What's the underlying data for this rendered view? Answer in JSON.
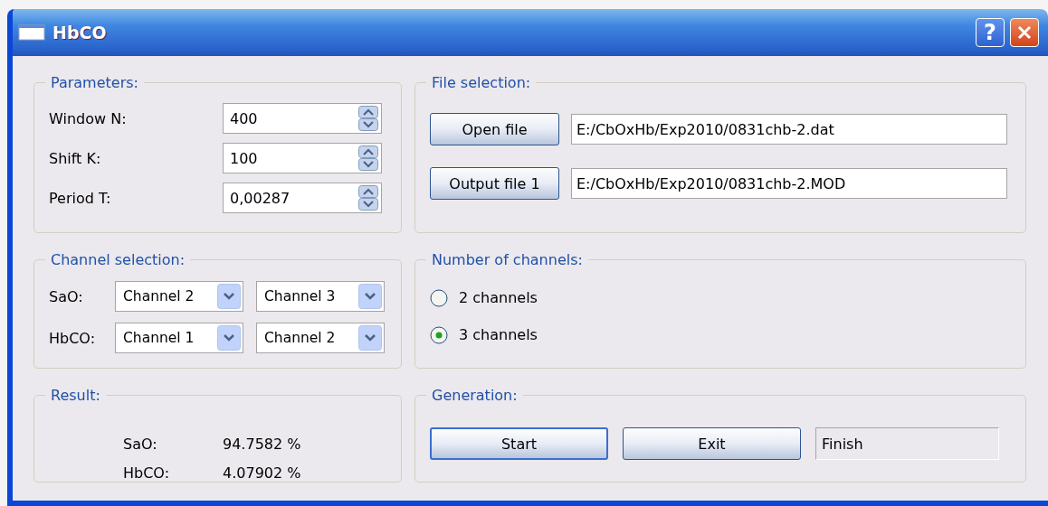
{
  "window": {
    "title": "HbCO",
    "help_button": "?"
  },
  "parameters": {
    "title": "Parameters:",
    "fields": [
      {
        "label": "Window N:",
        "value": "400"
      },
      {
        "label": "Shift K:",
        "value": "100"
      },
      {
        "label": "Period T:",
        "value": "0,00287"
      }
    ]
  },
  "file_selection": {
    "title": "File selection:",
    "rows": [
      {
        "button": "Open file",
        "path": "E:/CbOxHb/Exp2010/0831chb-2.dat"
      },
      {
        "button": "Output file 1",
        "path": "E:/CbOxHb/Exp2010/0831chb-2.MOD"
      }
    ]
  },
  "channel_selection": {
    "title": "Channel selection:",
    "rows": [
      {
        "label": "SaO:",
        "selects": [
          "Channel 2",
          "Channel 3"
        ]
      },
      {
        "label": "HbCO:",
        "selects": [
          "Channel 1",
          "Channel 2"
        ]
      }
    ]
  },
  "number_of_channels": {
    "title": "Number of channels:",
    "options": [
      {
        "label": "2 channels",
        "selected": false
      },
      {
        "label": "3 channels",
        "selected": true
      }
    ]
  },
  "result": {
    "title": "Result:",
    "rows": [
      {
        "label": "SaO:",
        "value": "94.7582 %"
      },
      {
        "label": "HbCO:",
        "value": "4.07902 %"
      }
    ]
  },
  "generation": {
    "title": "Generation:",
    "buttons": [
      {
        "label": "Start",
        "focused": true
      },
      {
        "label": "Exit",
        "focused": false
      }
    ],
    "status": "Finish"
  }
}
